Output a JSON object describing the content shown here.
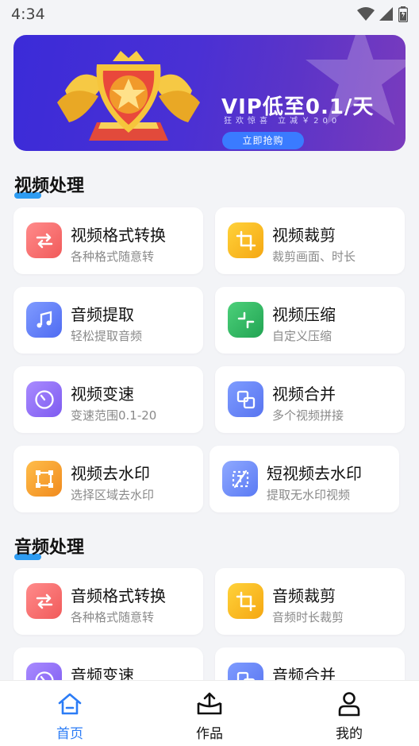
{
  "status_bar": {
    "time": "4:34"
  },
  "banner": {
    "title": "VIP低至0.1/天",
    "subtitle": "狂欢惊喜 立减￥200",
    "button_label": "立即抢购"
  },
  "sections": {
    "video": {
      "title": "视频处理",
      "items": [
        {
          "title": "视频格式转换",
          "subtitle": "各种格式随意转",
          "icon": "swap-icon"
        },
        {
          "title": "视频裁剪",
          "subtitle": "裁剪画面、时长",
          "icon": "crop-icon"
        },
        {
          "title": "音频提取",
          "subtitle": "轻松提取音频",
          "icon": "music-note-icon"
        },
        {
          "title": "视频压缩",
          "subtitle": "自定义压缩",
          "icon": "compress-icon"
        },
        {
          "title": "视频变速",
          "subtitle": "变速范围0.1-20",
          "icon": "speed-icon"
        },
        {
          "title": "视频合并",
          "subtitle": "多个视频拼接",
          "icon": "merge-icon"
        },
        {
          "title": "视频去水印",
          "subtitle": "选择区域去水印",
          "icon": "region-select-icon"
        },
        {
          "title": "短视频去水印",
          "subtitle": "提取无水印视频",
          "icon": "no-watermark-icon"
        }
      ]
    },
    "audio": {
      "title": "音频处理",
      "items": [
        {
          "title": "音频格式转换",
          "subtitle": "各种格式随意转",
          "icon": "swap-icon"
        },
        {
          "title": "音频裁剪",
          "subtitle": "音频时长裁剪",
          "icon": "crop-icon"
        },
        {
          "title": "音频变速",
          "subtitle": "",
          "icon": "speed-icon"
        },
        {
          "title": "音频合并",
          "subtitle": "",
          "icon": "merge-icon"
        }
      ]
    }
  },
  "bottom_nav": {
    "items": [
      {
        "label": "首页",
        "icon": "home-icon",
        "active": true
      },
      {
        "label": "作品",
        "icon": "works-icon",
        "active": false
      },
      {
        "label": "我的",
        "icon": "profile-icon",
        "active": false
      }
    ]
  },
  "colors": {
    "accent": "#2b7cf6",
    "banner_start": "#3b2bd8",
    "banner_end": "#7a3bbd"
  }
}
